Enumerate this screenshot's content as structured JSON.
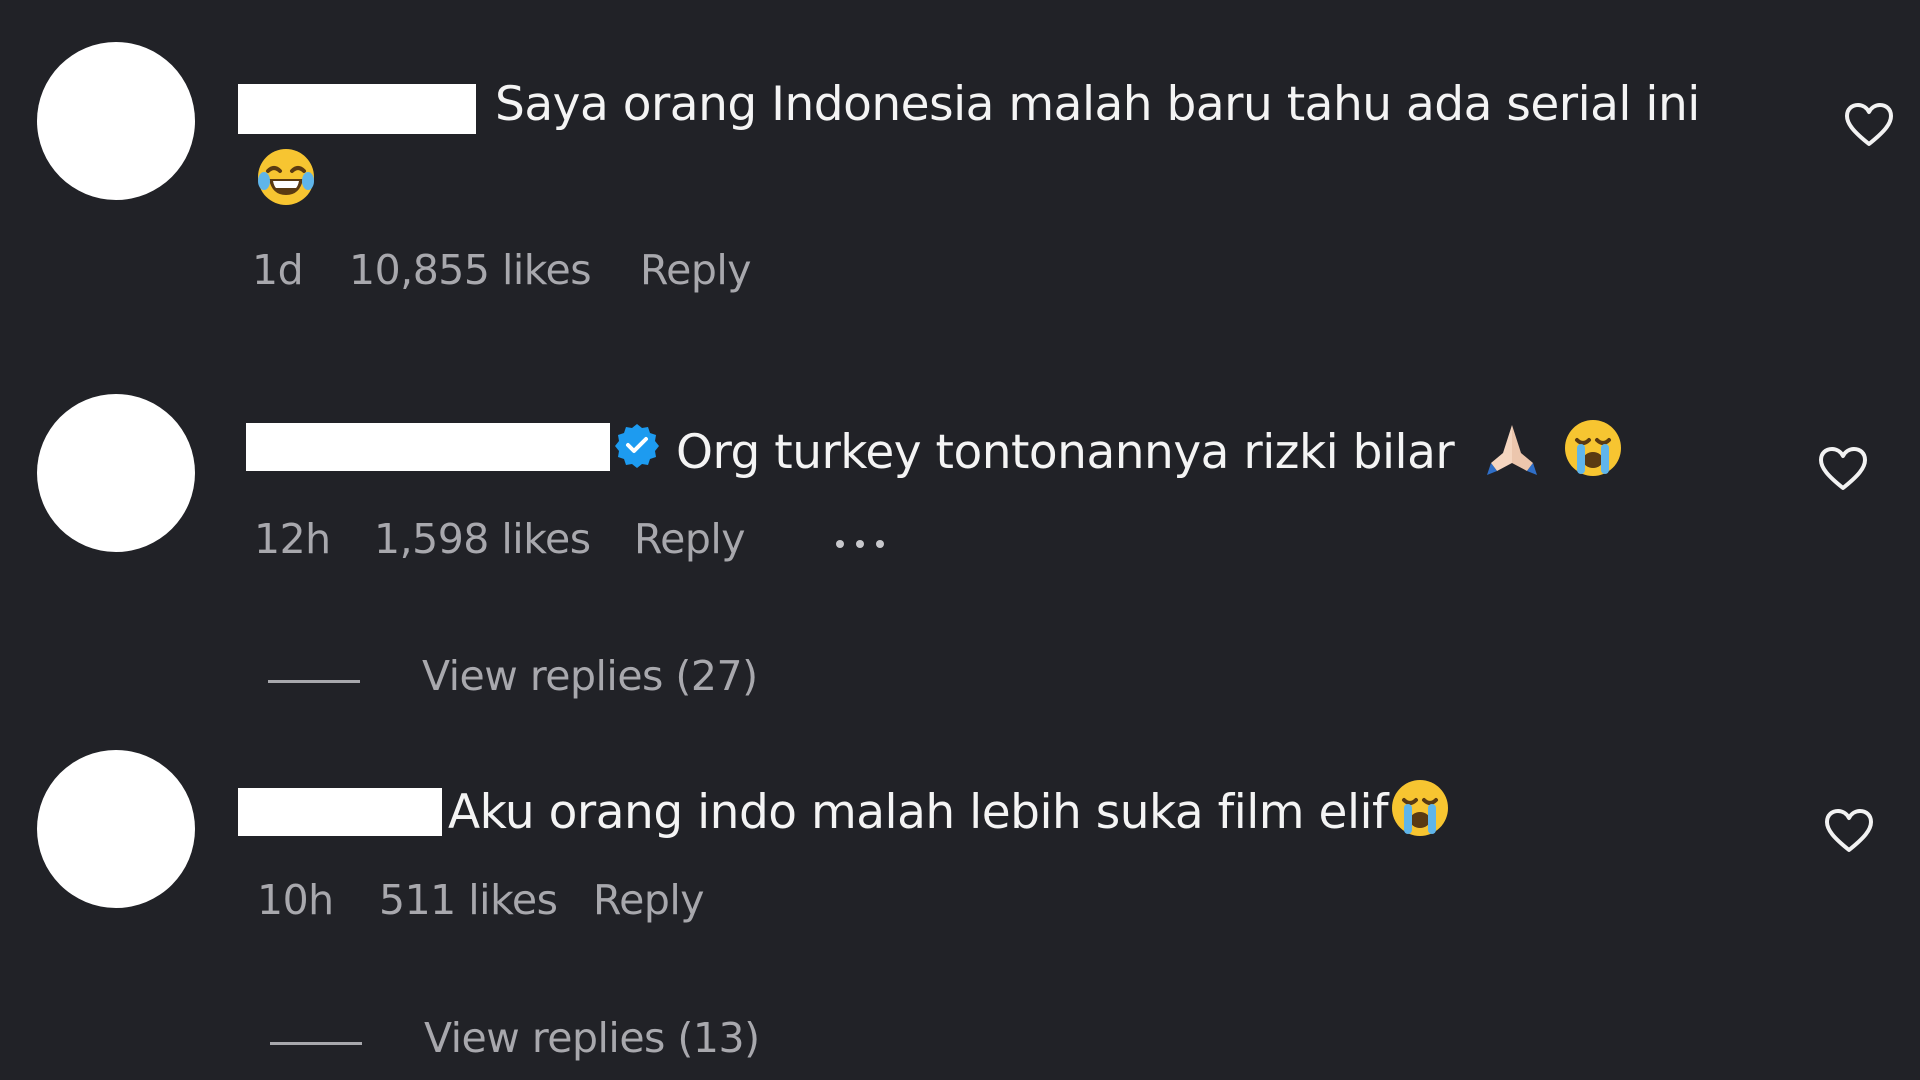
{
  "comments": [
    {
      "text": "Saya orang Indonesia malah baru tahu ada serial ini",
      "emoji": "laughing-tears",
      "time": "1d",
      "likes": "10,855 likes",
      "reply_label": "Reply",
      "verified": false
    },
    {
      "text": "Org turkey tontonannya rizki bilar",
      "emoji": "pray, crying",
      "time": "12h",
      "likes": "1,598 likes",
      "reply_label": "Reply",
      "verified": true,
      "view_replies": "View replies (27)"
    },
    {
      "text": "Aku orang indo malah lebih suka film elif",
      "emoji": "crying",
      "time": "10h",
      "likes": "511 likes",
      "reply_label": "Reply",
      "verified": false,
      "view_replies": "View replies (13)"
    }
  ],
  "colors": {
    "background": "#212227",
    "text": "#f4f4f4",
    "muted": "#a8a8ad",
    "verified": "#1d9bf0"
  }
}
